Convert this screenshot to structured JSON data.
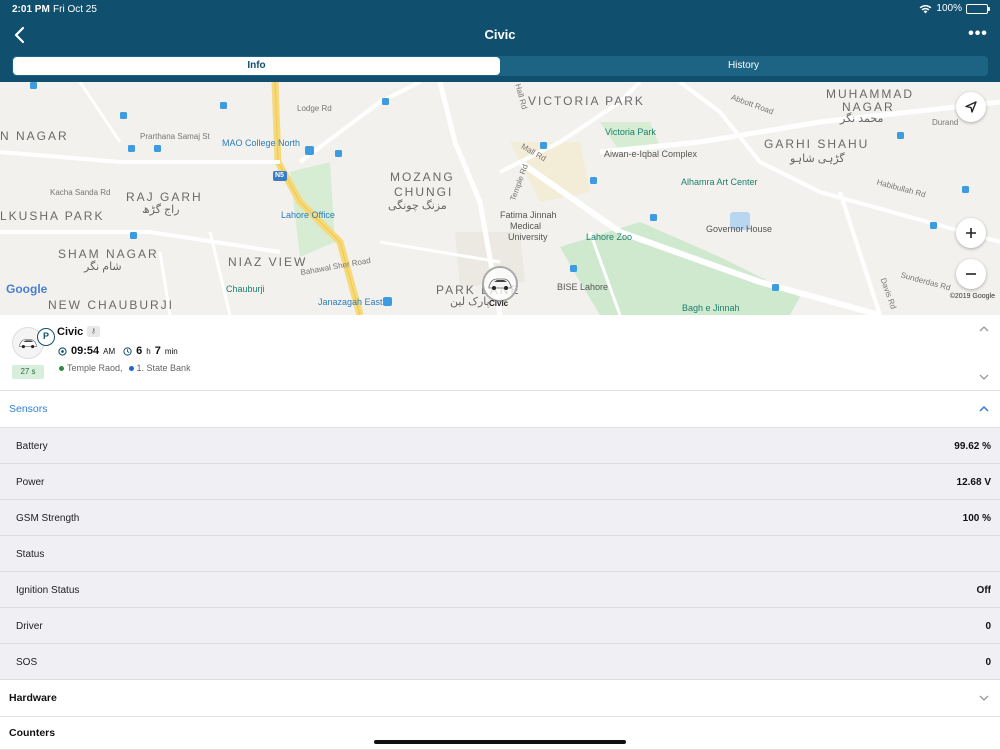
{
  "status_bar": {
    "time": "2:01 PM",
    "date": "Fri Oct 25",
    "battery": "100%"
  },
  "nav": {
    "title": "Civic"
  },
  "tabs": [
    {
      "label": "Info",
      "active": true
    },
    {
      "label": "History",
      "active": false
    }
  ],
  "map": {
    "areas": [
      {
        "text": "VICTORIA PARK"
      },
      {
        "text": "MUHAMMAD"
      },
      {
        "text": "NAGAR"
      },
      {
        "text": "N NAGAR"
      },
      {
        "text": "GARHI SHAHU"
      },
      {
        "text": "MOZANG"
      },
      {
        "text": "CHUNGI"
      },
      {
        "text": "RAJ GARH"
      },
      {
        "text": "LKUSHA PARK"
      },
      {
        "text": "SHAM NAGAR"
      },
      {
        "text": "NIAZ VIEW"
      },
      {
        "text": "PARK LANE"
      },
      {
        "text": "NEW CHAUBURJI"
      }
    ],
    "urdu": [
      {
        "text": "محمد نگر"
      },
      {
        "text": "گڑہی شاہو"
      },
      {
        "text": "مزنگ چونگی"
      },
      {
        "text": "راج گڑھ"
      },
      {
        "text": "شام نگر"
      },
      {
        "text": "پارک لین"
      }
    ],
    "pois": [
      {
        "text": "Victoria Park"
      },
      {
        "text": "Aiwan-e-Iqbal Complex"
      },
      {
        "text": "Alhamra Art Center"
      },
      {
        "text": "MAO College North"
      },
      {
        "text": "Lahore Office"
      },
      {
        "text": "Fatima Jinnah"
      },
      {
        "text": "Medical"
      },
      {
        "text": "University"
      },
      {
        "text": "Governor House"
      },
      {
        "text": "Lahore Zoo"
      },
      {
        "text": "Chauburji"
      },
      {
        "text": "Janazagah East"
      },
      {
        "text": "BISE Lahore"
      },
      {
        "text": "Bagh e Jinnah"
      }
    ],
    "roads": [
      {
        "text": "Lodge Rd"
      },
      {
        "text": "Hall Rd"
      },
      {
        "text": "Abbott Road"
      },
      {
        "text": "Mall Rd"
      },
      {
        "text": "Durand"
      },
      {
        "text": "Kacha Sanda Rd"
      },
      {
        "text": "Temple Rd"
      },
      {
        "text": "Bahawal Sher Road"
      },
      {
        "text": "Sunderdas Rd"
      },
      {
        "text": "Davis Rd"
      },
      {
        "text": "Habibullah Rd"
      },
      {
        "text": "Prarthana Samaj St"
      },
      {
        "text": "N5"
      }
    ],
    "car_label": "Civic",
    "google_logo": "Google",
    "copyright": "©2019 Google"
  },
  "vehicle": {
    "name": "Civic",
    "parking_badge": "P",
    "key_icon": "⚷",
    "duration_badge": "27 s",
    "time": "09:54",
    "time_suffix": "AM",
    "elapsed_hours": "6",
    "elapsed_h_unit": "h",
    "elapsed_minutes": "7",
    "elapsed_min_unit": "min",
    "address": "Temple Raod,",
    "place": "1. State Bank"
  },
  "sections": {
    "sensors": "Sensors",
    "hardware": "Hardware",
    "counters": "Counters"
  },
  "sensors": [
    {
      "label": "Battery",
      "value": "99.62 %"
    },
    {
      "label": "Power",
      "value": "12.68 V"
    },
    {
      "label": "GSM Strength",
      "value": "100 %"
    },
    {
      "label": "Status",
      "value": ""
    },
    {
      "label": "Ignition Status",
      "value": "Off"
    },
    {
      "label": "Driver",
      "value": "0"
    },
    {
      "label": "SOS",
      "value": "0"
    }
  ],
  "colors": {
    "header": "#10506e",
    "accent_blue": "#2f7fd8",
    "duration_badge_bg": "#d8eedd"
  }
}
